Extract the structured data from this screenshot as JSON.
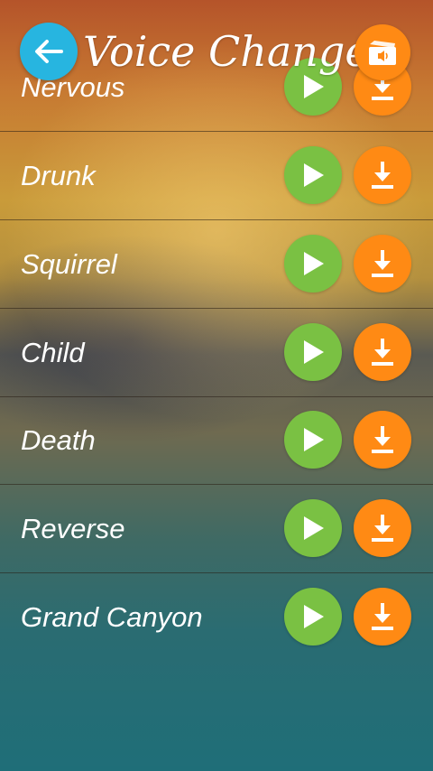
{
  "header": {
    "title": "Voice Changer",
    "back_icon": "arrow-left-icon",
    "folder_icon": "sound-folder-icon"
  },
  "effects": [
    {
      "label": "Nervous"
    },
    {
      "label": "Drunk"
    },
    {
      "label": "Squirrel"
    },
    {
      "label": "Child"
    },
    {
      "label": "Death"
    },
    {
      "label": "Reverse"
    },
    {
      "label": "Grand Canyon"
    }
  ],
  "colors": {
    "back_button": "#27b5e0",
    "play_button": "#7ac143",
    "download_button": "#ff8a14"
  }
}
